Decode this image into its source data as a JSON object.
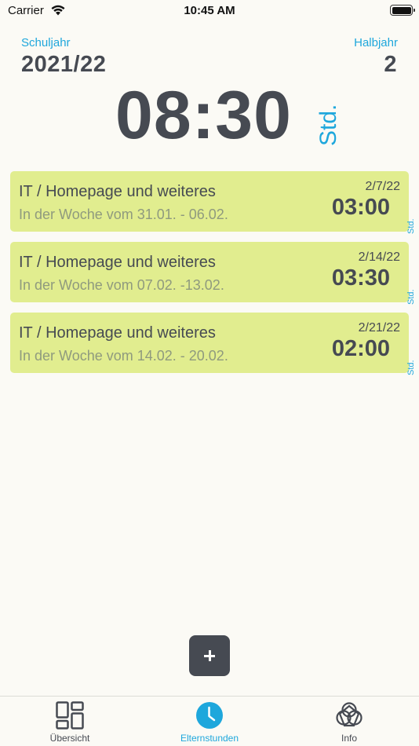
{
  "status_bar": {
    "carrier": "Carrier",
    "time": "10:45 AM"
  },
  "header": {
    "school_year_label": "Schuljahr",
    "school_year": "2021/22",
    "semester_label": "Halbjahr",
    "semester": "2"
  },
  "total": {
    "hours": "08:30",
    "unit": "Std."
  },
  "entries": [
    {
      "title": "IT / Homepage und weiteres",
      "subtitle": "In der Woche vom 31.01. - 06.02.",
      "date": "2/7/22",
      "hours": "03:00",
      "unit": "Std."
    },
    {
      "title": "IT / Homepage und weiteres",
      "subtitle": "In der Woche vom 07.02. -13.02.",
      "date": "2/14/22",
      "hours": "03:30",
      "unit": "Std."
    },
    {
      "title": "IT / Homepage und weiteres",
      "subtitle": "In der Woche vom 14.02. - 20.02.",
      "date": "2/21/22",
      "hours": "02:00",
      "unit": "Std."
    }
  ],
  "add_button": {
    "label": "+"
  },
  "tabs": [
    {
      "label": "Übersicht",
      "icon": "dashboard-grid-icon",
      "active": false
    },
    {
      "label": "Elternstunden",
      "icon": "clock-icon",
      "active": true
    },
    {
      "label": "Info",
      "icon": "flower-info-icon",
      "active": false
    }
  ],
  "colors": {
    "accent": "#1ea7dc",
    "entry_bg": "#e1ed8f",
    "text_dark": "#464a52",
    "background": "#fbfaf5"
  }
}
